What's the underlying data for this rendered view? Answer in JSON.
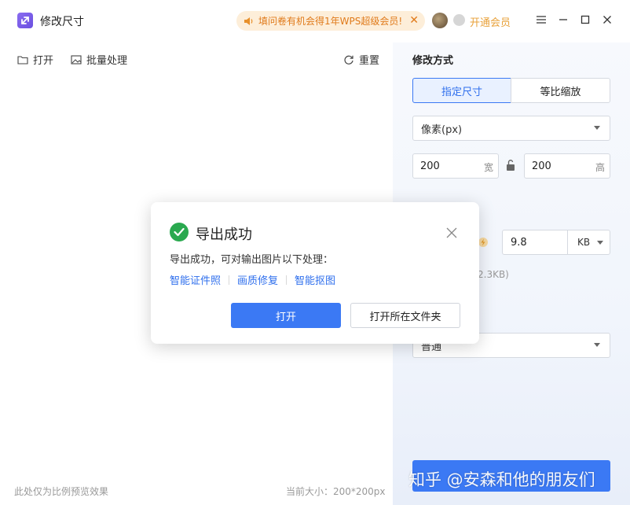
{
  "app": {
    "title": "修改尺寸",
    "icon": "resize-arrows-icon"
  },
  "promo": {
    "text": "填问卷有机会得1年WPS超级会员!",
    "icon": "speaker-icon",
    "close_icon": "close-icon"
  },
  "account": {
    "vip_label": "开通会员",
    "avatar": "avatar"
  },
  "window_controls": {
    "menu_icon": "hamburger-icon",
    "minimize_icon": "minimize-icon",
    "maximize_icon": "maximize-icon",
    "close_icon": "close-icon"
  },
  "toolbar": {
    "open_label": "打开",
    "batch_label": "批量处理",
    "reset_label": "重置"
  },
  "preview": {
    "footer_hint": "此处仅为比例预览效果",
    "current_size": "当前大小：200*200px"
  },
  "side": {
    "section_title": "修改方式",
    "tabs": [
      {
        "label": "指定尺寸",
        "active": true
      },
      {
        "label": "等比缩放",
        "active": false
      }
    ],
    "unit_select": "像素(px)",
    "width": {
      "value": "200",
      "unit": "宽"
    },
    "height": {
      "value": "200",
      "unit": "高"
    },
    "file_size": {
      "value": "9.8",
      "unit": "KB",
      "hint_partial": "2.3KB)"
    },
    "quality_select": "普通",
    "save_label": ""
  },
  "dialog": {
    "title": "导出成功",
    "message": "导出成功，可对输出图片以下处理：",
    "links": [
      "智能证件照",
      "画质修复",
      "智能抠图"
    ],
    "primary_label": "打开",
    "secondary_label": "打开所在文件夹"
  },
  "watermark": "知乎 @安森和他的朋友们",
  "colors": {
    "accent": "#3b79f4",
    "success": "#2aa94f",
    "promo_text": "#e07a1a",
    "vip_text": "#e8a13a"
  }
}
